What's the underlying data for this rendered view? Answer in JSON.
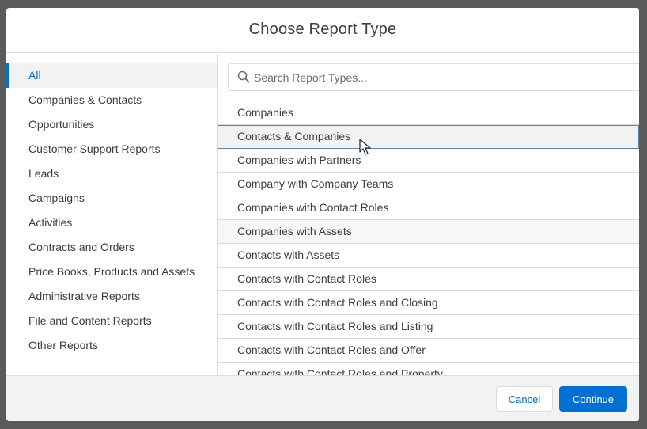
{
  "modal": {
    "title": "Choose Report Type"
  },
  "sidebar": {
    "items": [
      {
        "label": "All",
        "active": true
      },
      {
        "label": "Companies & Contacts"
      },
      {
        "label": "Opportunities"
      },
      {
        "label": "Customer Support Reports"
      },
      {
        "label": "Leads"
      },
      {
        "label": "Campaigns"
      },
      {
        "label": "Activities"
      },
      {
        "label": "Contracts and Orders"
      },
      {
        "label": "Price Books, Products and Assets"
      },
      {
        "label": "Administrative Reports"
      },
      {
        "label": "File and Content Reports"
      },
      {
        "label": "Other Reports"
      }
    ]
  },
  "search": {
    "placeholder": "Search Report Types...",
    "value": "",
    "icon": "search-icon"
  },
  "report_types": {
    "items": [
      {
        "label": "Companies"
      },
      {
        "label": "Contacts & Companies",
        "selected": true
      },
      {
        "label": "Companies with Partners"
      },
      {
        "label": "Company with Company Teams"
      },
      {
        "label": "Companies with Contact Roles"
      },
      {
        "label": "Companies with Assets",
        "hovered": true
      },
      {
        "label": "Contacts with Assets"
      },
      {
        "label": "Contacts with Contact Roles"
      },
      {
        "label": "Contacts with Contact Roles and Closing"
      },
      {
        "label": "Contacts with Contact Roles and Listing"
      },
      {
        "label": "Contacts with Contact Roles and Offer"
      },
      {
        "label": "Contacts with Contact Roles and Property"
      }
    ]
  },
  "footer": {
    "cancel_label": "Cancel",
    "continue_label": "Continue"
  },
  "colors": {
    "accent": "#0070d2",
    "text": "#3e3e3c",
    "border": "#dddbda",
    "selected_bg": "#f3f2f2"
  }
}
